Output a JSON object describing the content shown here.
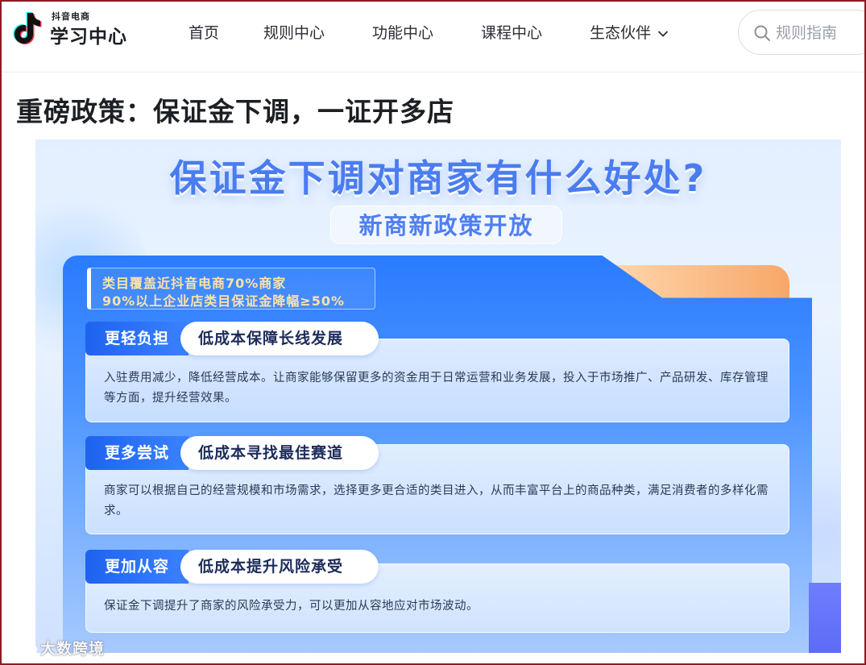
{
  "logo": {
    "small": "抖音电商",
    "big": "学习中心"
  },
  "nav": [
    {
      "label": "首页"
    },
    {
      "label": "规则中心"
    },
    {
      "label": "功能中心"
    },
    {
      "label": "课程中心"
    },
    {
      "label": "生态伙伴"
    }
  ],
  "search": {
    "placeholder": "规则指南"
  },
  "page_title": "重磅政策：保证金下调，一证开多店",
  "banner": {
    "headline": "保证金下调对商家有什么好处?",
    "subhead": "新商新政策开放",
    "highlight": [
      "类目覆盖近抖音电商70%商家",
      "90%以上企业店类目保证金降幅≥50%"
    ],
    "cards": [
      {
        "tag": "更轻负担",
        "title": "低成本保障长线发展",
        "text": "入驻费用减少，降低经营成本。让商家能够保留更多的资金用于日常运营和业务发展，投入于市场推广、产品研发、库存管理等方面，提升经营效果。"
      },
      {
        "tag": "更多尝试",
        "title": "低成本寻找最佳赛道",
        "text": "商家可以根据自己的经营规模和市场需求，选择更多更合适的类目进入，从而丰富平台上的商品种类，满足消费者的多样化需求。"
      },
      {
        "tag": "更加从容",
        "title": "低成本提升风险承受",
        "text": "保证金下调提升了商家的风险承受力，可以更加从容地应对市场波动。"
      }
    ]
  },
  "watermark": "大数跨境",
  "colors": {
    "accent": "#2a7bff",
    "headline": "#4a7cf0",
    "highlight_text": "#ffe3a6",
    "frame": "#8a1c24"
  }
}
